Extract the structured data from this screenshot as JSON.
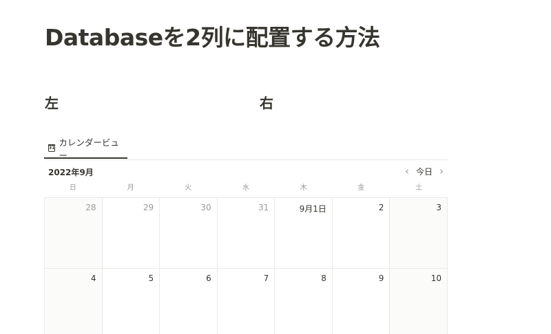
{
  "page": {
    "title": "Databaseを2列に配置する方法",
    "left_heading": "左",
    "right_heading": "右"
  },
  "view": {
    "tab_label": "カレンダービュー",
    "tab_icon": "calendar-icon",
    "tab_icon_text": "31"
  },
  "calendar": {
    "month_label": "2022年9月",
    "today_label": "今日",
    "prev_icon": "chevron-left-icon",
    "next_icon": "chevron-right-icon",
    "weekdays": [
      "日",
      "月",
      "火",
      "水",
      "木",
      "金",
      "土"
    ],
    "days": [
      {
        "label": "28",
        "other": true
      },
      {
        "label": "29",
        "other": true
      },
      {
        "label": "30",
        "other": true
      },
      {
        "label": "31",
        "other": true
      },
      {
        "label": "9月1日",
        "other": false
      },
      {
        "label": "2",
        "other": false
      },
      {
        "label": "3",
        "other": false
      },
      {
        "label": "4",
        "other": false
      },
      {
        "label": "5",
        "other": false
      },
      {
        "label": "6",
        "other": false
      },
      {
        "label": "7",
        "other": false
      },
      {
        "label": "8",
        "other": false
      },
      {
        "label": "9",
        "other": false
      },
      {
        "label": "10",
        "other": false
      }
    ]
  },
  "colors": {
    "text": "#37352f",
    "muted": "#9b9a97",
    "border": "#e9e9e7",
    "weekend_bg": "#fbfbfa"
  }
}
